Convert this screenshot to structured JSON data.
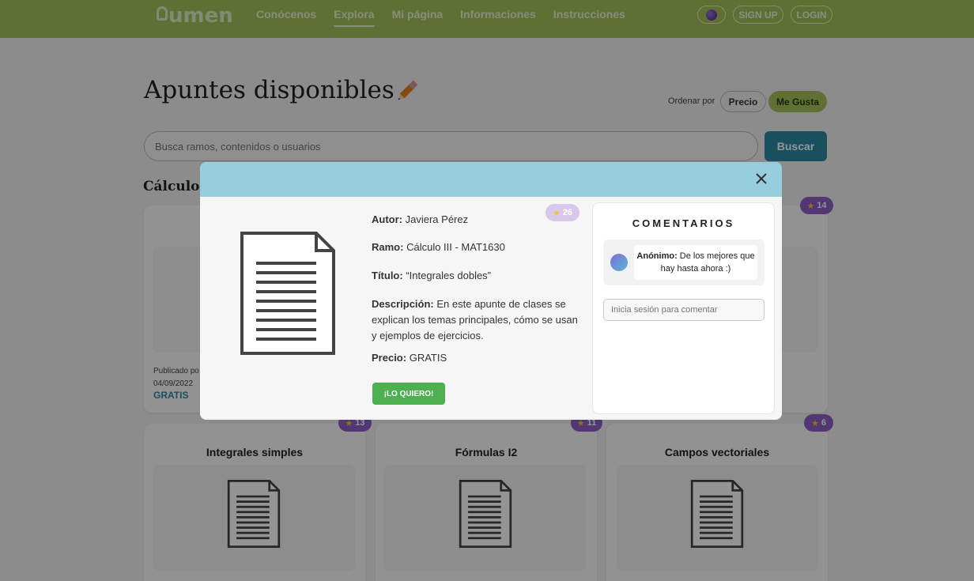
{
  "header": {
    "logo": "umen",
    "nav": [
      {
        "label": "Conócenos"
      },
      {
        "label": "Explora"
      },
      {
        "label": "Mi página"
      },
      {
        "label": "Informaciones"
      },
      {
        "label": "Instrucciones"
      }
    ],
    "signup": "SIGN UP",
    "login": "LOGIN"
  },
  "page": {
    "title": "Apuntes disponibles",
    "sort_label": "Ordenar por",
    "sort_price": "Precio",
    "sort_likes": "Me Gusta",
    "search_placeholder": "Busca ramos, contenidos o usuarios",
    "search_button": "Buscar",
    "section_title": "Cálculo I"
  },
  "cards": [
    {
      "likes": "14",
      "published": "Publicado po",
      "date": "04/09/2022",
      "price": "GRATIS"
    },
    {
      "title": "Integrales simples",
      "likes": "13"
    },
    {
      "title": "Fórmulas I2",
      "likes": "11"
    },
    {
      "title": "Campos vectoriales",
      "likes": "6"
    }
  ],
  "modal": {
    "likes": "26",
    "author_label": "Autor:",
    "author": "Javiera Pérez",
    "course_label": "Ramo:",
    "course": "Cálculo III - MAT1630",
    "title_label": "Título:",
    "title": "“Integrales dobles”",
    "desc_label": "Descripción:",
    "desc": "En este apunte de clases se explican los temas principales, cómo se usan y ejemplos de ejercicios.",
    "price_label": "Precio:",
    "price": "GRATIS",
    "want_button": "¡LO QUIERO!",
    "comments_title": "COMENTARIOS",
    "comment_author": "Anónimo:",
    "comment_text": "De los mejores que hay hasta ahora :)",
    "comment_placeholder": "Inicia sesión para comentar"
  },
  "colors": {
    "header": "#a5c25a",
    "modal_header": "#96cedd",
    "badge": "#8e5fc7",
    "primary": "#2b8aa6",
    "want": "#4caf50"
  }
}
